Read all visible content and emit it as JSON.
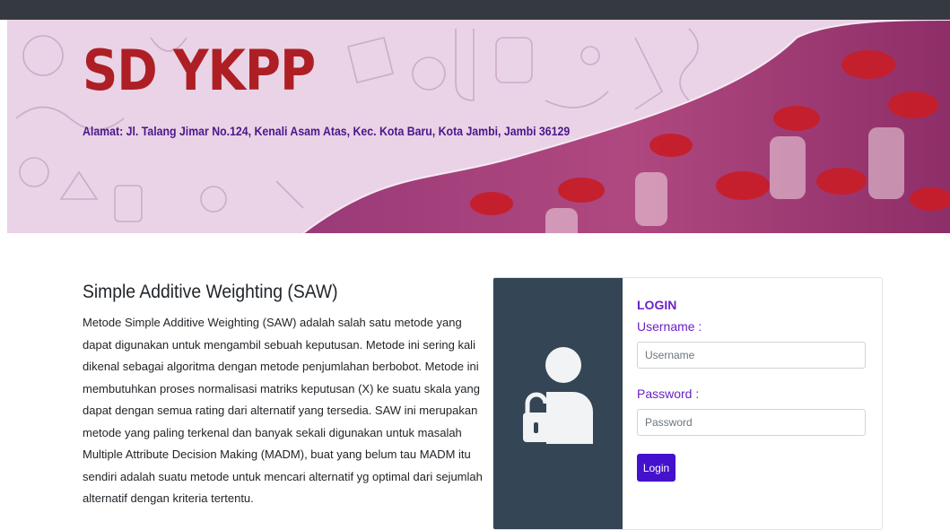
{
  "header": {
    "brand": "SD YKPP",
    "address": "Alamat: Jl. Talang Jimar No.124, Kenali Asam Atas, Kec. Kota Baru, Kota Jambi, Jambi 36129"
  },
  "intro": {
    "title": "Simple Additive Weighting (SAW)",
    "body": "Metode Simple Additive Weighting (SAW) adalah salah satu metode yang dapat digunakan untuk mengambil sebuah keputusan. Metode ini sering kali dikenal sebagai algoritma dengan metode penjumlahan berbobot. Metode ini membutuhkan proses normalisasi matriks keputusan (X) ke suatu skala yang dapat dengan semua rating dari alternatif yang tersedia. SAW ini merupakan metode yang paling terkenal dan banyak sekali digunakan untuk masalah Multiple Attribute Decision Making (MADM), buat yang belum tau MADM itu sendiri adalah suatu metode untuk mencari alternatif yg optimal dari sejumlah alternatif dengan kriteria tertentu."
  },
  "login": {
    "title": "LOGIN",
    "username_label": "Username :",
    "username_placeholder": "Username",
    "password_label": "Password :",
    "password_placeholder": "Password",
    "button_label": "Login",
    "icon": "user-lock-icon"
  },
  "colors": {
    "brand": "#ad1f24",
    "address": "#4b168c",
    "accent": "#6b21c8",
    "button": "#4411cc",
    "sidebar": "#344555",
    "topbar": "#343a40"
  }
}
